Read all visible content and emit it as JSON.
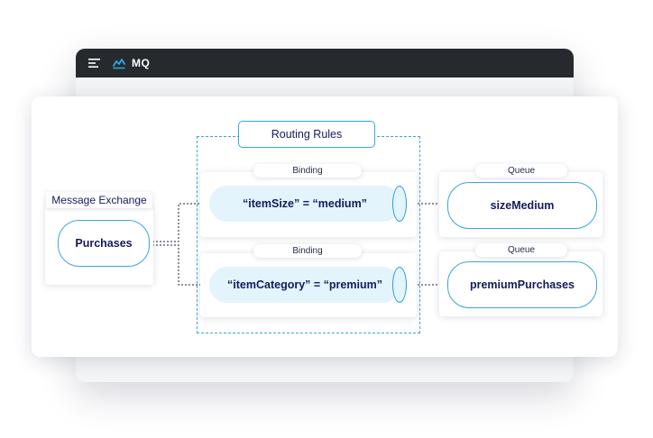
{
  "app": {
    "title": "MQ",
    "menu_icon": "hamburger-menu-icon",
    "logo_icon": "mq-logo-icon"
  },
  "colors": {
    "accent": "#3aa6dc",
    "text": "#141b5c",
    "binding_fill": "#e3f4fc",
    "titlebar": "#262a2f"
  },
  "routing_rules": {
    "label": "Routing Rules"
  },
  "exchange": {
    "label": "Message Exchange",
    "name": "Purchases"
  },
  "bindings": [
    {
      "tab": "Binding",
      "rule": "“itemSize” = “medium”"
    },
    {
      "tab": "Binding",
      "rule": "“itemCategory” = “premium”"
    }
  ],
  "queues": [
    {
      "tab": "Queue",
      "name": "sizeMedium"
    },
    {
      "tab": "Queue",
      "name": "premiumPurchases"
    }
  ]
}
